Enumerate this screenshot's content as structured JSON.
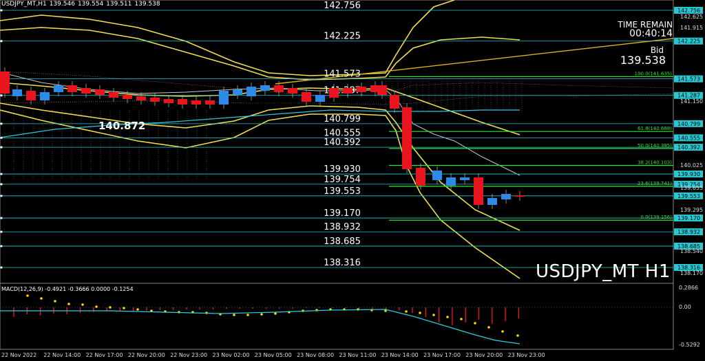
{
  "header": {
    "symbol_tf": "USDJPY_MT,H1",
    "open": "139.546",
    "high": "139.554",
    "low": "139.511",
    "close": "139.538"
  },
  "info": {
    "time_remain_label": "TIME REMAIN",
    "time_remain_value": "00:40:14",
    "bid_label": "Bid",
    "bid_value": "139.538",
    "symbol_big": "USDJPY_MT H1",
    "highlight_price": "140.872"
  },
  "levels": [
    {
      "price": "142.756",
      "label": "142.756"
    },
    {
      "price": "142.225",
      "label": "142.225"
    },
    {
      "price": "141.573",
      "label": "141.573"
    },
    {
      "price": "141.287",
      "label": "141.287"
    },
    {
      "price": "140.799",
      "label": "140.799"
    },
    {
      "price": "140.555",
      "label": "140.555"
    },
    {
      "price": "140.392",
      "label": "140.392"
    },
    {
      "price": "139.930",
      "label": "139.930"
    },
    {
      "price": "139.754",
      "label": "139.754"
    },
    {
      "price": "139.553",
      "label": "139.553"
    },
    {
      "price": "139.170",
      "label": "139.170"
    },
    {
      "price": "138.932",
      "label": "138.932"
    },
    {
      "price": "138.685",
      "label": "138.685"
    },
    {
      "price": "138.316",
      "label": "138.316"
    }
  ],
  "fib": [
    {
      "label": "100.0(141.635)",
      "price": 141.635
    },
    {
      "label": "61.8(140.688)",
      "price": 140.688
    },
    {
      "label": "50.0(140.395)",
      "price": 140.395
    },
    {
      "label": "38.2(140.103)",
      "price": 140.103
    },
    {
      "label": "23.6(139.741)",
      "price": 139.741
    },
    {
      "label": "0.0(139.156)",
      "price": 139.156
    }
  ],
  "price_axis": {
    "ticks": [
      "142.625",
      "141.915",
      "141.150",
      "140.025",
      "139.655",
      "139.295",
      "138.540",
      "138.170"
    ]
  },
  "macd": {
    "label": "MACD(12,26,9) -0.4921 -0.3666 0.0000 -0.1254",
    "ticks": [
      "0.2866",
      "0.00",
      "-0.5292"
    ]
  },
  "time_axis": {
    "labels": [
      "22 Nov 2022",
      "22 Nov 14:00",
      "22 Nov 17:00",
      "22 Nov 20:00",
      "22 Nov 23:00",
      "23 Nov 02:00",
      "23 Nov 05:00",
      "23 Nov 08:00",
      "23 Nov 11:00",
      "23 Nov 14:00",
      "23 Nov 17:00",
      "23 Nov 20:00",
      "23 Nov 23:00"
    ]
  },
  "colors": {
    "background": "#000000",
    "bull": "#2e8ae6",
    "bear": "#e8141e",
    "level_line": "#28c8d2",
    "fib_line": "#32e632",
    "band": "#f0e050",
    "macd_signal": "#2ed0e0",
    "macd_dots": "#ffd400"
  }
}
